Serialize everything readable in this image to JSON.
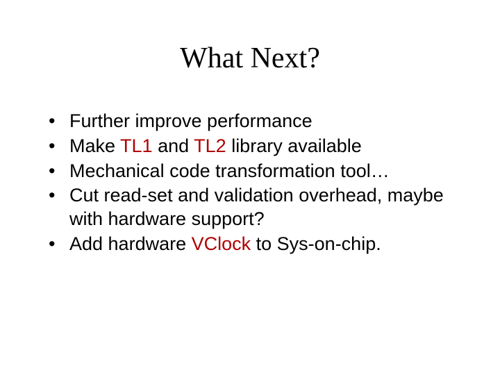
{
  "slide": {
    "title": "What Next?",
    "bullets": [
      {
        "pre": "Further improve performance",
        "hl": "",
        "post": ""
      },
      {
        "pre": "Make ",
        "hl": "TL1",
        "mid": " and ",
        "hl2": "TL2",
        "post": " library available"
      },
      {
        "pre": "Mechanical code transformation tool…",
        "hl": "",
        "post": ""
      },
      {
        "pre": "Cut read-set and validation overhead, maybe with hardware support?",
        "hl": "",
        "post": ""
      },
      {
        "pre": "Add hardware ",
        "hl": "VClock",
        "post": " to Sys-on-chip."
      }
    ]
  }
}
